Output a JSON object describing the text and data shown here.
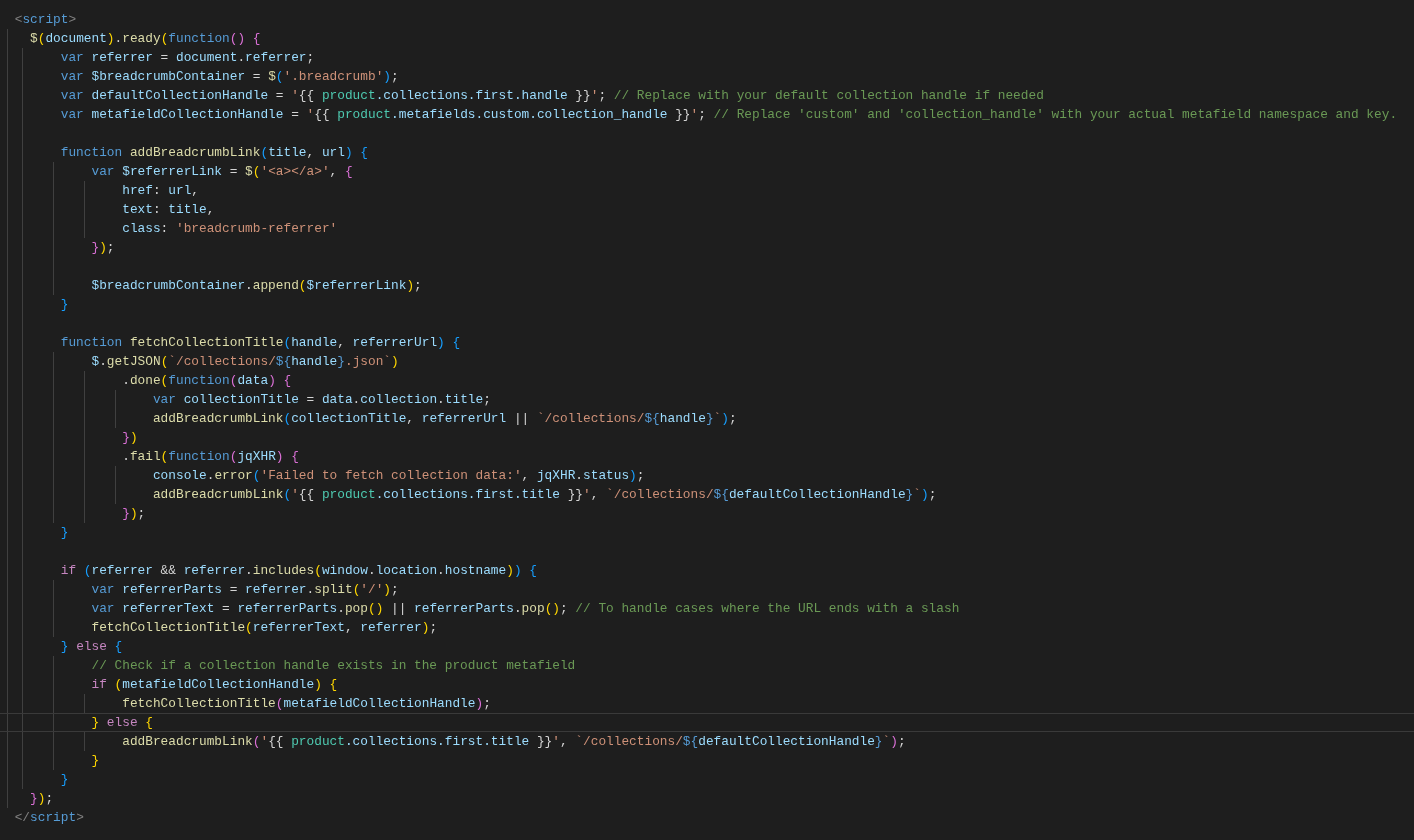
{
  "editor": {
    "lines": [
      {
        "current": false,
        "tokens": [
          {
            "kind": "tp",
            "text": "<"
          },
          {
            "kind": "tag",
            "text": "script"
          },
          {
            "kind": "tp",
            "text": ">"
          }
        ]
      },
      {
        "current": false,
        "tokens": [
          {
            "kind": "fn",
            "text": "  $"
          },
          {
            "kind": "y",
            "text": "("
          },
          {
            "kind": "v",
            "text": "document"
          },
          {
            "kind": "y",
            "text": ")"
          },
          {
            "kind": "p",
            "text": "."
          },
          {
            "kind": "fn",
            "text": "ready"
          },
          {
            "kind": "y",
            "text": "("
          },
          {
            "kind": "kw",
            "text": "function"
          },
          {
            "kind": "m",
            "text": "() {"
          }
        ]
      },
      {
        "current": false,
        "tokens": [
          {
            "kind": "kw",
            "text": "      var "
          },
          {
            "kind": "v",
            "text": "referrer"
          },
          {
            "kind": "p",
            "text": " = "
          },
          {
            "kind": "v",
            "text": "document"
          },
          {
            "kind": "p",
            "text": "."
          },
          {
            "kind": "v",
            "text": "referrer"
          },
          {
            "kind": "p",
            "text": ";"
          }
        ]
      },
      {
        "current": false,
        "tokens": [
          {
            "kind": "kw",
            "text": "      var "
          },
          {
            "kind": "v",
            "text": "$breadcrumbContainer"
          },
          {
            "kind": "p",
            "text": " = "
          },
          {
            "kind": "fn",
            "text": "$"
          },
          {
            "kind": "b",
            "text": "("
          },
          {
            "kind": "s",
            "text": "'.breadcrumb'"
          },
          {
            "kind": "b",
            "text": ")"
          },
          {
            "kind": "p",
            "text": ";"
          }
        ]
      },
      {
        "current": false,
        "tokens": [
          {
            "kind": "kw",
            "text": "      var "
          },
          {
            "kind": "v",
            "text": "defaultCollectionHandle"
          },
          {
            "kind": "p",
            "text": " = "
          },
          {
            "kind": "s",
            "text": "'"
          },
          {
            "kind": "p",
            "text": "{{ "
          },
          {
            "kind": "t",
            "text": "product"
          },
          {
            "kind": "v",
            "text": ".collections.first.handle"
          },
          {
            "kind": "p",
            "text": " }}"
          },
          {
            "kind": "s",
            "text": "'"
          },
          {
            "kind": "p",
            "text": "; "
          },
          {
            "kind": "c",
            "text": "// Replace with your default collection handle if needed"
          }
        ]
      },
      {
        "current": false,
        "tokens": [
          {
            "kind": "kw",
            "text": "      var "
          },
          {
            "kind": "v",
            "text": "metafieldCollectionHandle"
          },
          {
            "kind": "p",
            "text": " = "
          },
          {
            "kind": "s",
            "text": "'"
          },
          {
            "kind": "p",
            "text": "{{ "
          },
          {
            "kind": "t",
            "text": "product"
          },
          {
            "kind": "v",
            "text": ".metafields.custom.collection_handle"
          },
          {
            "kind": "p",
            "text": " }}"
          },
          {
            "kind": "s",
            "text": "'"
          },
          {
            "kind": "p",
            "text": "; "
          },
          {
            "kind": "c",
            "text": "// Replace 'custom' and 'collection_handle' with your actual metafield namespace and key."
          }
        ]
      },
      {
        "current": false
      },
      {
        "current": false,
        "tokens": [
          {
            "kind": "kw",
            "text": "      function "
          },
          {
            "kind": "fn",
            "text": "addBreadcrumbLink"
          },
          {
            "kind": "b",
            "text": "("
          },
          {
            "kind": "v",
            "text": "title"
          },
          {
            "kind": "p",
            "text": ", "
          },
          {
            "kind": "v",
            "text": "url"
          },
          {
            "kind": "b",
            "text": ") {"
          }
        ]
      },
      {
        "current": false,
        "tokens": [
          {
            "kind": "kw",
            "text": "          var "
          },
          {
            "kind": "v",
            "text": "$referrerLink"
          },
          {
            "kind": "p",
            "text": " = "
          },
          {
            "kind": "fn",
            "text": "$"
          },
          {
            "kind": "y",
            "text": "("
          },
          {
            "kind": "s",
            "text": "'<a></a>'"
          },
          {
            "kind": "p",
            "text": ", "
          },
          {
            "kind": "m",
            "text": "{"
          }
        ]
      },
      {
        "current": false,
        "tokens": [
          {
            "kind": "v",
            "text": "              href"
          },
          {
            "kind": "p",
            "text": ": "
          },
          {
            "kind": "v",
            "text": "url"
          },
          {
            "kind": "p",
            "text": ","
          }
        ]
      },
      {
        "current": false,
        "tokens": [
          {
            "kind": "v",
            "text": "              text"
          },
          {
            "kind": "p",
            "text": ": "
          },
          {
            "kind": "v",
            "text": "title"
          },
          {
            "kind": "p",
            "text": ","
          }
        ]
      },
      {
        "current": false,
        "tokens": [
          {
            "kind": "v",
            "text": "              class"
          },
          {
            "kind": "p",
            "text": ": "
          },
          {
            "kind": "s",
            "text": "'breadcrumb-referrer'"
          }
        ]
      },
      {
        "current": false,
        "tokens": [
          {
            "kind": "m",
            "text": "          }"
          },
          {
            "kind": "y",
            "text": ")"
          },
          {
            "kind": "p",
            "text": ";"
          }
        ]
      },
      {
        "current": false
      },
      {
        "current": false,
        "tokens": [
          {
            "kind": "v",
            "text": "          $breadcrumbContainer"
          },
          {
            "kind": "p",
            "text": "."
          },
          {
            "kind": "fn",
            "text": "append"
          },
          {
            "kind": "y",
            "text": "("
          },
          {
            "kind": "v",
            "text": "$referrerLink"
          },
          {
            "kind": "y",
            "text": ")"
          },
          {
            "kind": "p",
            "text": ";"
          }
        ]
      },
      {
        "current": false,
        "tokens": [
          {
            "kind": "b",
            "text": "      }"
          }
        ]
      },
      {
        "current": false
      },
      {
        "current": false,
        "tokens": [
          {
            "kind": "kw",
            "text": "      function "
          },
          {
            "kind": "fn",
            "text": "fetchCollectionTitle"
          },
          {
            "kind": "b",
            "text": "("
          },
          {
            "kind": "v",
            "text": "handle"
          },
          {
            "kind": "p",
            "text": ", "
          },
          {
            "kind": "v",
            "text": "referrerUrl"
          },
          {
            "kind": "b",
            "text": ") {"
          }
        ]
      },
      {
        "current": false,
        "tokens": [
          {
            "kind": "v",
            "text": "          $"
          },
          {
            "kind": "p",
            "text": "."
          },
          {
            "kind": "fn",
            "text": "getJSON"
          },
          {
            "kind": "y",
            "text": "("
          },
          {
            "kind": "s",
            "text": "`/collections/"
          },
          {
            "kind": "kw",
            "text": "${"
          },
          {
            "kind": "v",
            "text": "handle"
          },
          {
            "kind": "kw",
            "text": "}"
          },
          {
            "kind": "s",
            "text": ".json`"
          },
          {
            "kind": "y",
            "text": ")"
          }
        ]
      },
      {
        "current": false,
        "tokens": [
          {
            "kind": "p",
            "text": "              ."
          },
          {
            "kind": "fn",
            "text": "done"
          },
          {
            "kind": "y",
            "text": "("
          },
          {
            "kind": "kw",
            "text": "function"
          },
          {
            "kind": "m",
            "text": "("
          },
          {
            "kind": "v",
            "text": "data"
          },
          {
            "kind": "m",
            "text": ") {"
          }
        ]
      },
      {
        "current": false,
        "tokens": [
          {
            "kind": "kw",
            "text": "                  var "
          },
          {
            "kind": "v",
            "text": "collectionTitle"
          },
          {
            "kind": "p",
            "text": " = "
          },
          {
            "kind": "v",
            "text": "data"
          },
          {
            "kind": "p",
            "text": "."
          },
          {
            "kind": "v",
            "text": "collection"
          },
          {
            "kind": "p",
            "text": "."
          },
          {
            "kind": "v",
            "text": "title"
          },
          {
            "kind": "p",
            "text": ";"
          }
        ]
      },
      {
        "current": false,
        "tokens": [
          {
            "kind": "fn",
            "text": "                  addBreadcrumbLink"
          },
          {
            "kind": "b",
            "text": "("
          },
          {
            "kind": "v",
            "text": "collectionTitle"
          },
          {
            "kind": "p",
            "text": ", "
          },
          {
            "kind": "v",
            "text": "referrerUrl"
          },
          {
            "kind": "p",
            "text": " || "
          },
          {
            "kind": "s",
            "text": "`/collections/"
          },
          {
            "kind": "kw",
            "text": "${"
          },
          {
            "kind": "v",
            "text": "handle"
          },
          {
            "kind": "kw",
            "text": "}"
          },
          {
            "kind": "s",
            "text": "`"
          },
          {
            "kind": "b",
            "text": ")"
          },
          {
            "kind": "p",
            "text": ";"
          }
        ]
      },
      {
        "current": false,
        "tokens": [
          {
            "kind": "m",
            "text": "              }"
          },
          {
            "kind": "y",
            "text": ")"
          }
        ]
      },
      {
        "current": false,
        "tokens": [
          {
            "kind": "p",
            "text": "              ."
          },
          {
            "kind": "fn",
            "text": "fail"
          },
          {
            "kind": "y",
            "text": "("
          },
          {
            "kind": "kw",
            "text": "function"
          },
          {
            "kind": "m",
            "text": "("
          },
          {
            "kind": "v",
            "text": "jqXHR"
          },
          {
            "kind": "m",
            "text": ") {"
          }
        ]
      },
      {
        "current": false,
        "tokens": [
          {
            "kind": "v",
            "text": "                  console"
          },
          {
            "kind": "p",
            "text": "."
          },
          {
            "kind": "fn",
            "text": "error"
          },
          {
            "kind": "b",
            "text": "("
          },
          {
            "kind": "s",
            "text": "'Failed to fetch collection data:'"
          },
          {
            "kind": "p",
            "text": ", "
          },
          {
            "kind": "v",
            "text": "jqXHR"
          },
          {
            "kind": "p",
            "text": "."
          },
          {
            "kind": "v",
            "text": "status"
          },
          {
            "kind": "b",
            "text": ")"
          },
          {
            "kind": "p",
            "text": ";"
          }
        ]
      },
      {
        "current": false,
        "tokens": [
          {
            "kind": "fn",
            "text": "                  addBreadcrumbLink"
          },
          {
            "kind": "b",
            "text": "("
          },
          {
            "kind": "s",
            "text": "'"
          },
          {
            "kind": "p",
            "text": "{{ "
          },
          {
            "kind": "t",
            "text": "product"
          },
          {
            "kind": "v",
            "text": ".collections.first.title"
          },
          {
            "kind": "p",
            "text": " }}"
          },
          {
            "kind": "s",
            "text": "'"
          },
          {
            "kind": "p",
            "text": ", "
          },
          {
            "kind": "s",
            "text": "`/collections/"
          },
          {
            "kind": "kw",
            "text": "${"
          },
          {
            "kind": "v",
            "text": "defaultCollectionHandle"
          },
          {
            "kind": "kw",
            "text": "}"
          },
          {
            "kind": "s",
            "text": "`"
          },
          {
            "kind": "b",
            "text": ")"
          },
          {
            "kind": "p",
            "text": ";"
          }
        ]
      },
      {
        "current": false,
        "tokens": [
          {
            "kind": "m",
            "text": "              }"
          },
          {
            "kind": "y",
            "text": ")"
          },
          {
            "kind": "p",
            "text": ";"
          }
        ]
      },
      {
        "current": false,
        "tokens": [
          {
            "kind": "b",
            "text": "      }"
          }
        ]
      },
      {
        "current": false
      },
      {
        "current": false,
        "tokens": [
          {
            "kind": "ctl",
            "text": "      if "
          },
          {
            "kind": "b",
            "text": "("
          },
          {
            "kind": "v",
            "text": "referrer"
          },
          {
            "kind": "p",
            "text": " && "
          },
          {
            "kind": "v",
            "text": "referrer"
          },
          {
            "kind": "p",
            "text": "."
          },
          {
            "kind": "fn",
            "text": "includes"
          },
          {
            "kind": "y",
            "text": "("
          },
          {
            "kind": "v",
            "text": "window"
          },
          {
            "kind": "p",
            "text": "."
          },
          {
            "kind": "v",
            "text": "location"
          },
          {
            "kind": "p",
            "text": "."
          },
          {
            "kind": "v",
            "text": "hostname"
          },
          {
            "kind": "y",
            "text": ")"
          },
          {
            "kind": "b",
            "text": ") {"
          }
        ]
      },
      {
        "current": false,
        "tokens": [
          {
            "kind": "kw",
            "text": "          var "
          },
          {
            "kind": "v",
            "text": "referrerParts"
          },
          {
            "kind": "p",
            "text": " = "
          },
          {
            "kind": "v",
            "text": "referrer"
          },
          {
            "kind": "p",
            "text": "."
          },
          {
            "kind": "fn",
            "text": "split"
          },
          {
            "kind": "y",
            "text": "("
          },
          {
            "kind": "s",
            "text": "'/'"
          },
          {
            "kind": "y",
            "text": ")"
          },
          {
            "kind": "p",
            "text": ";"
          }
        ]
      },
      {
        "current": false,
        "tokens": [
          {
            "kind": "kw",
            "text": "          var "
          },
          {
            "kind": "v",
            "text": "referrerText"
          },
          {
            "kind": "p",
            "text": " = "
          },
          {
            "kind": "v",
            "text": "referrerParts"
          },
          {
            "kind": "p",
            "text": "."
          },
          {
            "kind": "fn",
            "text": "pop"
          },
          {
            "kind": "y",
            "text": "()"
          },
          {
            "kind": "p",
            "text": " || "
          },
          {
            "kind": "v",
            "text": "referrerParts"
          },
          {
            "kind": "p",
            "text": "."
          },
          {
            "kind": "fn",
            "text": "pop"
          },
          {
            "kind": "y",
            "text": "()"
          },
          {
            "kind": "p",
            "text": "; "
          },
          {
            "kind": "c",
            "text": "// To handle cases where the URL ends with a slash"
          }
        ]
      },
      {
        "current": false,
        "tokens": [
          {
            "kind": "fn",
            "text": "          fetchCollectionTitle"
          },
          {
            "kind": "y",
            "text": "("
          },
          {
            "kind": "v",
            "text": "referrerText"
          },
          {
            "kind": "p",
            "text": ", "
          },
          {
            "kind": "v",
            "text": "referrer"
          },
          {
            "kind": "y",
            "text": ")"
          },
          {
            "kind": "p",
            "text": ";"
          }
        ]
      },
      {
        "current": false,
        "tokens": [
          {
            "kind": "b",
            "text": "      } "
          },
          {
            "kind": "ctl",
            "text": "else "
          },
          {
            "kind": "b",
            "text": "{"
          }
        ]
      },
      {
        "current": false,
        "tokens": [
          {
            "kind": "c",
            "text": "          // Check if a collection handle exists in the product metafield"
          }
        ]
      },
      {
        "current": false,
        "tokens": [
          {
            "kind": "ctl",
            "text": "          if "
          },
          {
            "kind": "y",
            "text": "("
          },
          {
            "kind": "v",
            "text": "metafieldCollectionHandle"
          },
          {
            "kind": "y",
            "text": ") {"
          }
        ]
      },
      {
        "current": false,
        "tokens": [
          {
            "kind": "fn",
            "text": "              fetchCollectionTitle"
          },
          {
            "kind": "m",
            "text": "("
          },
          {
            "kind": "v",
            "text": "metafieldCollectionHandle"
          },
          {
            "kind": "m",
            "text": ")"
          },
          {
            "kind": "p",
            "text": ";"
          }
        ]
      },
      {
        "current": true,
        "tokens": [
          {
            "kind": "y",
            "text": "          } "
          },
          {
            "kind": "ctl",
            "text": "else "
          },
          {
            "kind": "y",
            "text": "{"
          }
        ]
      },
      {
        "current": false,
        "tokens": [
          {
            "kind": "fn",
            "text": "              addBreadcrumbLink"
          },
          {
            "kind": "m",
            "text": "("
          },
          {
            "kind": "s",
            "text": "'"
          },
          {
            "kind": "p",
            "text": "{{ "
          },
          {
            "kind": "t",
            "text": "product"
          },
          {
            "kind": "v",
            "text": ".collections.first.title"
          },
          {
            "kind": "p",
            "text": " }}"
          },
          {
            "kind": "s",
            "text": "'"
          },
          {
            "kind": "p",
            "text": ", "
          },
          {
            "kind": "s",
            "text": "`/collections/"
          },
          {
            "kind": "kw",
            "text": "${"
          },
          {
            "kind": "v",
            "text": "defaultCollectionHandle"
          },
          {
            "kind": "kw",
            "text": "}"
          },
          {
            "kind": "s",
            "text": "`"
          },
          {
            "kind": "m",
            "text": ")"
          },
          {
            "kind": "p",
            "text": ";"
          }
        ]
      },
      {
        "current": false,
        "tokens": [
          {
            "kind": "y",
            "text": "          }"
          }
        ]
      },
      {
        "current": false,
        "tokens": [
          {
            "kind": "b",
            "text": "      }"
          }
        ]
      },
      {
        "current": false,
        "tokens": [
          {
            "kind": "m",
            "text": "  }"
          },
          {
            "kind": "y",
            "text": ")"
          },
          {
            "kind": "p",
            "text": ";"
          }
        ]
      },
      {
        "current": false,
        "tokens": [
          {
            "kind": "tp",
            "text": "</"
          },
          {
            "kind": "tag",
            "text": "script"
          },
          {
            "kind": "tp",
            "text": ">"
          }
        ]
      }
    ]
  }
}
